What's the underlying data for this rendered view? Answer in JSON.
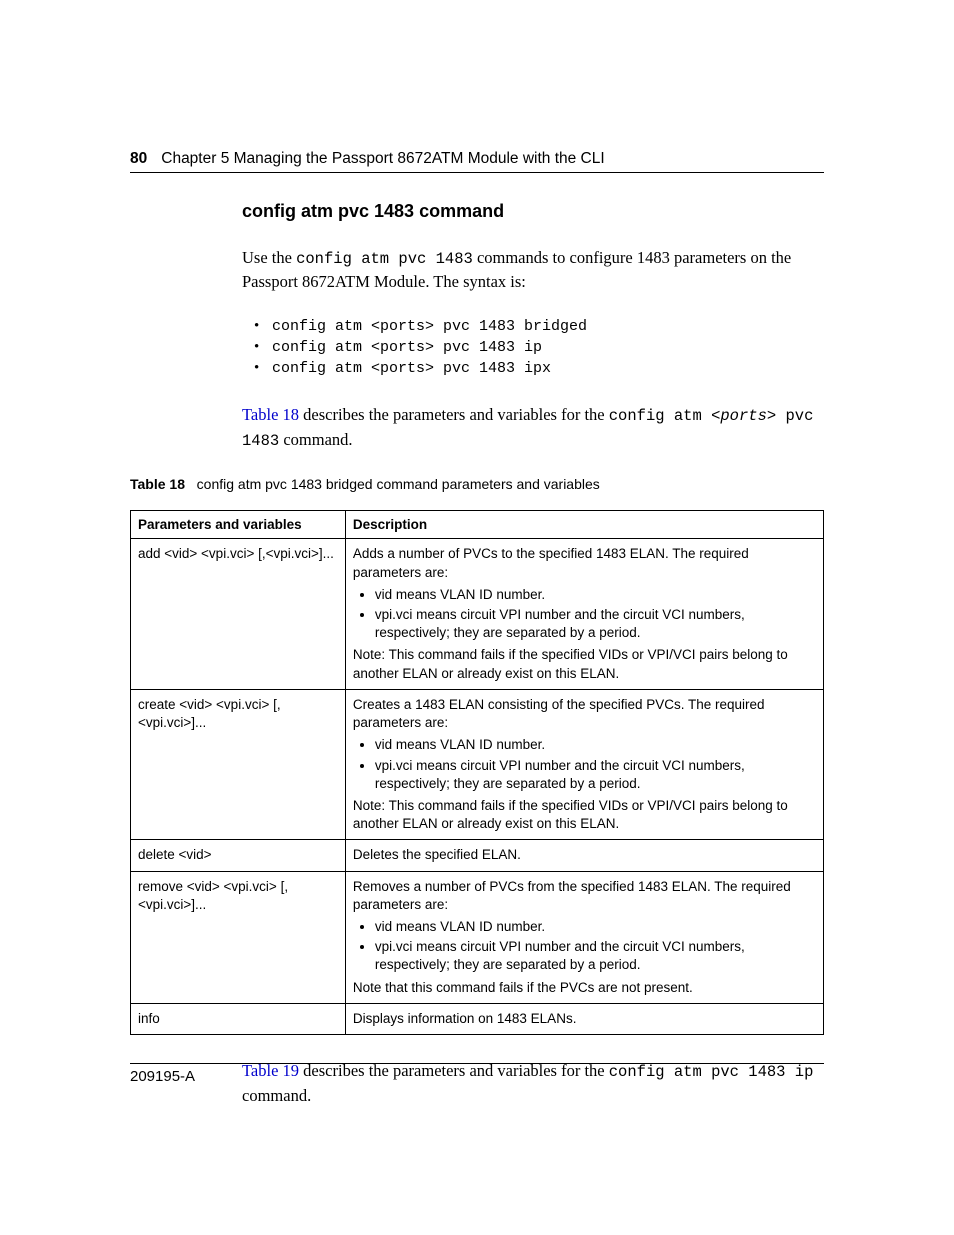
{
  "header": {
    "page_number": "80",
    "running_head": "Chapter 5  Managing the Passport 8672ATM Module with the CLI"
  },
  "heading": "config atm pvc 1483 command",
  "intro": {
    "pre": "Use the ",
    "cmd": "config atm pvc 1483",
    "post": " commands to configure 1483 parameters on the Passport 8672ATM Module. The syntax is:"
  },
  "commands": [
    "config atm <ports> pvc 1483 bridged",
    "config atm <ports> pvc 1483 ip",
    "config atm <ports> pvc 1483 ipx"
  ],
  "table18_lead": {
    "xref": "Table 18",
    "mid": " describes the parameters and variables for the ",
    "code1": "config atm <",
    "code_it": "ports",
    "code2": "> pvc 1483",
    "tail": " command."
  },
  "table18": {
    "label": "Table 18",
    "title": "config atm pvc 1483 bridged command parameters and variables",
    "columns": [
      "Parameters and variables",
      "Description"
    ],
    "rows": [
      {
        "param": "add <vid> <vpi.vci> [,<vpi.vci>]...",
        "desc_top": "Adds a number of PVCs to the specified 1483 ELAN. The required parameters are:",
        "bullets": [
          "vid means VLAN ID number.",
          "vpi.vci means circuit VPI number and the circuit VCI numbers, respectively; they are separated by a period."
        ],
        "note": "Note: This command fails if the specified VIDs or VPI/VCI pairs belong to another ELAN or already exist on this ELAN."
      },
      {
        "param": "create <vid> <vpi.vci> [,<vpi.vci>]...",
        "desc_top": "Creates a 1483 ELAN consisting of the specified PVCs. The required parameters are:",
        "bullets": [
          "vid means VLAN ID number.",
          "vpi.vci means circuit VPI number and the circuit VCI numbers, respectively; they are separated by a period."
        ],
        "note": "Note: This command fails if the specified VIDs or VPI/VCI pairs belong to another ELAN or already exist on this ELAN."
      },
      {
        "param": "delete <vid>",
        "desc_top": "Deletes the specified ELAN.",
        "bullets": [],
        "note": ""
      },
      {
        "param": "remove <vid> <vpi.vci> [,<vpi.vci>]...",
        "desc_top": "Removes a number of PVCs from the specified 1483 ELAN. The required parameters are:",
        "bullets": [
          "vid means VLAN ID number.",
          "vpi.vci means circuit VPI number and the circuit VCI numbers, respectively; they are separated by a period."
        ],
        "note": "Note that this command fails if the PVCs are not present."
      },
      {
        "param": "info",
        "desc_top": "Displays information on 1483 ELANs.",
        "bullets": [],
        "note": ""
      }
    ]
  },
  "table19_lead": {
    "xref": "Table 19",
    "mid": " describes the parameters and variables for the ",
    "code": "config atm pvc 1483 ip",
    "tail": " command."
  },
  "footer": "209195-A"
}
